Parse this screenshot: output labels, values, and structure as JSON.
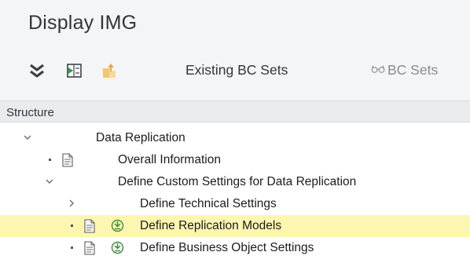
{
  "window": {
    "title": "Display IMG"
  },
  "toolbar": {
    "icons": [
      "expand-all-icon",
      "execute-icon",
      "bc-set-icon"
    ],
    "existing_bc_sets_label": "Existing BC Sets",
    "bc_sets_label": "BC Sets"
  },
  "tree": {
    "header": "Structure",
    "nodes": [
      {
        "label": "Data Replication"
      },
      {
        "label": "Overall Information"
      },
      {
        "label": "Define Custom Settings for Data Replication"
      },
      {
        "label": "Define Technical Settings"
      },
      {
        "label": "Define Replication Models"
      },
      {
        "label": "Define Business Object Settings"
      }
    ]
  },
  "colors": {
    "selected_row": "#fdf6b1",
    "execute_icon": "#3b8d3b",
    "doc_icon": "#5a5a5a"
  }
}
